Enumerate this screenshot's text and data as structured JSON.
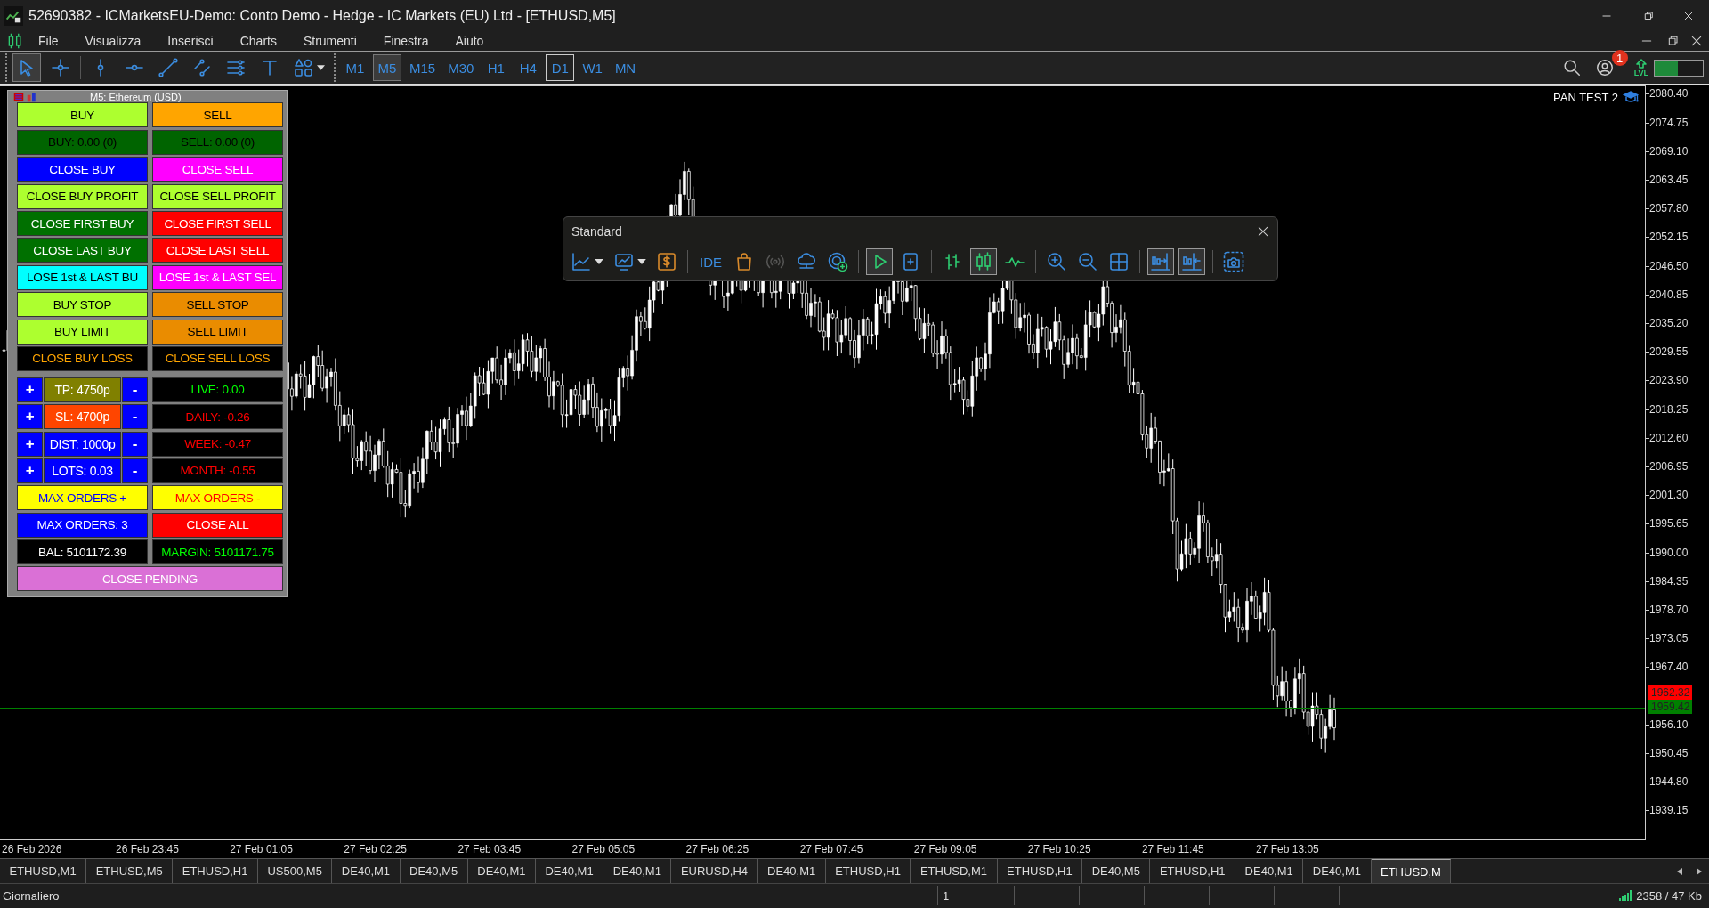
{
  "window": {
    "title": "52690382 - ICMarketsEU-Demo: Conto Demo - Hedge - IC Markets (EU) Ltd - [ETHUSD,M5]"
  },
  "menu": [
    "File",
    "Visualizza",
    "Inserisci",
    "Charts",
    "Strumenti",
    "Finestra",
    "Aiuto"
  ],
  "toolbar": {
    "tools": [
      {
        "kind": "cursor",
        "selected": true
      },
      {
        "kind": "crosshair",
        "selected": false
      },
      {
        "kind": "vline",
        "selected": false
      },
      {
        "kind": "hline",
        "selected": false
      },
      {
        "kind": "trendline",
        "selected": false
      },
      {
        "kind": "channel",
        "selected": false
      },
      {
        "kind": "fibo",
        "selected": false
      },
      {
        "kind": "text",
        "selected": false
      },
      {
        "kind": "shapes",
        "selected": false
      }
    ],
    "timeframes": [
      {
        "label": "M1",
        "selected": false,
        "marked": false
      },
      {
        "label": "M5",
        "selected": true,
        "marked": false
      },
      {
        "label": "M15",
        "selected": false,
        "marked": false
      },
      {
        "label": "M30",
        "selected": false,
        "marked": false
      },
      {
        "label": "H1",
        "selected": false,
        "marked": false
      },
      {
        "label": "H4",
        "selected": false,
        "marked": false
      },
      {
        "label": "D1",
        "selected": false,
        "marked": true
      },
      {
        "label": "W1",
        "selected": false,
        "marked": false
      },
      {
        "label": "MN",
        "selected": false,
        "marked": false
      }
    ],
    "notification_badge": "1",
    "lvl_label": "LVL",
    "meter": {
      "level": 0.48
    }
  },
  "chart": {
    "caption": "M5:  Ethereum (USD)",
    "label": "PAN TEST 2",
    "price_ticks": [
      "2080.40",
      "2074.75",
      "2069.10",
      "2063.45",
      "2057.80",
      "2052.15",
      "2046.50",
      "2040.85",
      "2035.20",
      "2029.55",
      "2023.90",
      "2018.25",
      "2012.60",
      "2006.95",
      "2001.30",
      "1995.65",
      "1990.00",
      "1984.35",
      "1978.70",
      "1973.05",
      "1967.40",
      "1956.10",
      "1950.45",
      "1944.80",
      "1939.15"
    ],
    "price_lines": [
      {
        "text": "1962.32",
        "color": "#ff0000"
      },
      {
        "text": "1959.42",
        "color": "#008000"
      }
    ],
    "time_ticks": [
      "26 Feb 2026",
      "26 Feb 23:45",
      "27 Feb 01:05",
      "27 Feb 02:25",
      "27 Feb 03:45",
      "27 Feb 05:05",
      "27 Feb 06:25",
      "27 Feb 07:45",
      "27 Feb 09:05",
      "27 Feb 10:25",
      "27 Feb 11:45",
      "27 Feb 13:05"
    ]
  },
  "trade_panel": {
    "rows": [
      {
        "kind": "pair",
        "cells": [
          {
            "text": "BUY",
            "color": "#adff2f",
            "text_style": {
              "color": "#000000"
            }
          },
          {
            "text": "SELL",
            "color": "#ffa500",
            "text_style": {
              "color": "#000000"
            }
          }
        ]
      },
      {
        "kind": "pair",
        "cells": [
          {
            "text": "BUY: 0.00 (0)",
            "color": "#006400",
            "text_style": {
              "color": "#000000"
            }
          },
          {
            "text": "SELL: 0.00 (0)",
            "color": "#006400",
            "text_style": {
              "color": "#000000"
            }
          }
        ]
      },
      {
        "kind": "pair",
        "cells": [
          {
            "text": "CLOSE BUY",
            "color": "#0000ff",
            "text_style": {
              "color": "#ffffff"
            }
          },
          {
            "text": "CLOSE SELL",
            "color": "#ff00ff",
            "text_style": {
              "color": "#ffffff"
            }
          }
        ]
      },
      {
        "kind": "pair",
        "cells": [
          {
            "text": "CLOSE BUY PROFIT",
            "color": "#adff2f",
            "text_style": {
              "color": "#000000"
            }
          },
          {
            "text": "CLOSE SELL PROFIT",
            "color": "#adff2f",
            "text_style": {
              "color": "#000000"
            }
          }
        ]
      },
      {
        "kind": "pair",
        "cells": [
          {
            "text": "CLOSE FIRST BUY",
            "color": "#007000",
            "text_style": {
              "color": "#ffffff"
            }
          },
          {
            "text": "CLOSE FIRST SELL",
            "color": "#ff0000",
            "text_style": {
              "color": "#ffffff"
            }
          }
        ]
      },
      {
        "kind": "pair",
        "cells": [
          {
            "text": "CLOSE LAST BUY",
            "color": "#007000",
            "text_style": {
              "color": "#ffffff"
            }
          },
          {
            "text": "CLOSE LAST SELL",
            "color": "#ff0000",
            "text_style": {
              "color": "#ffffff"
            }
          }
        ]
      },
      {
        "kind": "pair",
        "cells": [
          {
            "text": "LOSE 1st & LAST BU",
            "color": "#00ffff",
            "text_style": {
              "color": "#000000"
            }
          },
          {
            "text": "LOSE 1st & LAST SEL",
            "color": "#ff00ff",
            "text_style": {
              "color": "#ffffff"
            }
          }
        ]
      },
      {
        "kind": "pair",
        "cells": [
          {
            "text": "BUY STOP",
            "color": "#adff2f",
            "text_style": {
              "color": "#000000"
            }
          },
          {
            "text": "SELL STOP",
            "color": "#ea8c00",
            "text_style": {
              "color": "#000000"
            }
          }
        ]
      },
      {
        "kind": "pair",
        "cells": [
          {
            "text": "BUY LIMIT",
            "color": "#adff2f",
            "text_style": {
              "color": "#000000"
            }
          },
          {
            "text": "SELL LIMIT",
            "color": "#ea8c00",
            "text_style": {
              "color": "#000000"
            }
          }
        ]
      },
      {
        "kind": "pair",
        "cells": [
          {
            "text": "CLOSE BUY LOSS",
            "color": "#000000",
            "text_style": {
              "color": "#ffa500"
            }
          },
          {
            "text": "CLOSE SELL LOSS",
            "color": "#000000",
            "text_style": {
              "color": "#ffa500"
            }
          }
        ]
      },
      {
        "kind": "stepper",
        "cells": [
          {
            "text": "+",
            "color": "#0000ff",
            "text_style": {
              "color": "#ffffff"
            }
          },
          {
            "text": "TP: 4750p",
            "color": "#808000",
            "text_style": {
              "color": "#ffffff"
            }
          },
          {
            "text": "-",
            "color": "#0000ff",
            "text_style": {
              "color": "#ffffff"
            }
          },
          {
            "text": "LIVE: 0.00",
            "color": "#000000",
            "text_style": {
              "color": "#00ff00"
            }
          }
        ]
      },
      {
        "kind": "stepper",
        "cells": [
          {
            "text": "+",
            "color": "#0000ff",
            "text_style": {
              "color": "#ffffff"
            }
          },
          {
            "text": "SL: 4700p",
            "color": "#ff4500",
            "text_style": {
              "color": "#ffffff"
            }
          },
          {
            "text": "-",
            "color": "#0000ff",
            "text_style": {
              "color": "#ffffff"
            }
          },
          {
            "text": "DAILY: -0.26",
            "color": "#000000",
            "text_style": {
              "color": "#ff0000"
            }
          }
        ]
      },
      {
        "kind": "stepper",
        "cells": [
          {
            "text": "+",
            "color": "#0000ff",
            "text_style": {
              "color": "#ffffff"
            }
          },
          {
            "text": "DIST: 1000p",
            "color": "#0000ff",
            "text_style": {
              "color": "#ffffff"
            }
          },
          {
            "text": "-",
            "color": "#0000ff",
            "text_style": {
              "color": "#ffffff"
            }
          },
          {
            "text": "WEEK: -0.47",
            "color": "#000000",
            "text_style": {
              "color": "#ff0000"
            }
          }
        ]
      },
      {
        "kind": "stepper",
        "cells": [
          {
            "text": "+",
            "color": "#0000ff",
            "text_style": {
              "color": "#ffffff"
            }
          },
          {
            "text": "LOTS: 0.03",
            "color": "#0000ff",
            "text_style": {
              "color": "#ffffff"
            }
          },
          {
            "text": "-",
            "color": "#0000ff",
            "text_style": {
              "color": "#ffffff"
            }
          },
          {
            "text": "MONTH: -0.55",
            "color": "#000000",
            "text_style": {
              "color": "#ff0000"
            }
          }
        ]
      },
      {
        "kind": "pair",
        "cells": [
          {
            "text": "MAX ORDERS +",
            "color": "#ffff00",
            "text_style": {
              "color": "#0000ff"
            }
          },
          {
            "text": "MAX ORDERS -",
            "color": "#ffff00",
            "text_style": {
              "color": "#ff0000"
            }
          }
        ]
      },
      {
        "kind": "pair",
        "cells": [
          {
            "text": "MAX ORDERS: 3",
            "color": "#0000ff",
            "text_style": {
              "color": "#ffffff"
            }
          },
          {
            "text": "CLOSE ALL",
            "color": "#ff0000",
            "text_style": {
              "color": "#ffffff"
            }
          }
        ]
      },
      {
        "kind": "pair",
        "cells": [
          {
            "text": "BAL: 5101172.39",
            "color": "#000000",
            "text_style": {
              "color": "#ffffff"
            }
          },
          {
            "text": "MARGIN: 5101171.75",
            "color": "#000000",
            "text_style": {
              "color": "#00ff00"
            }
          }
        ]
      },
      {
        "kind": "wide",
        "cells": [
          {
            "text": "CLOSE PENDING",
            "color": "#da70d6",
            "text_style": {
              "color": "#ffffff"
            }
          }
        ]
      }
    ]
  },
  "standard_toolbar": {
    "title": "Standard",
    "groups": [
      [
        {
          "kind": "line-chart",
          "on": false,
          "disabled": false
        },
        {
          "kind": "monitor-chart",
          "on": false,
          "disabled": false
        },
        {
          "kind": "dollar",
          "on": false,
          "disabled": false
        }
      ],
      [
        {
          "kind": "ide",
          "text": "IDE",
          "on": false,
          "disabled": false
        },
        {
          "kind": "bag",
          "on": false,
          "disabled": false
        },
        {
          "kind": "signal",
          "on": false,
          "disabled": true
        },
        {
          "kind": "cloud",
          "on": false,
          "disabled": false
        },
        {
          "kind": "add-target",
          "on": false,
          "disabled": false
        }
      ],
      [
        {
          "kind": "play",
          "on": true,
          "disabled": false
        },
        {
          "kind": "new-doc",
          "on": false,
          "disabled": false
        }
      ],
      [
        {
          "kind": "bars",
          "on": false,
          "disabled": false
        },
        {
          "kind": "candles",
          "on": true,
          "disabled": false
        },
        {
          "kind": "line-wave",
          "on": false,
          "disabled": false
        }
      ],
      [
        {
          "kind": "zoom-in",
          "on": false,
          "disabled": false
        },
        {
          "kind": "zoom-out",
          "on": false,
          "disabled": false
        },
        {
          "kind": "grid",
          "on": false,
          "disabled": false
        }
      ],
      [
        {
          "kind": "shift-right",
          "on": true,
          "disabled": false
        },
        {
          "kind": "shift-left",
          "on": true,
          "disabled": false
        }
      ],
      [
        {
          "kind": "camera",
          "on": false,
          "disabled": false
        }
      ]
    ]
  },
  "tabs": [
    {
      "label": "ETHUSD,M1",
      "selected": false
    },
    {
      "label": "ETHUSD,M5",
      "selected": false
    },
    {
      "label": "ETHUSD,H1",
      "selected": false
    },
    {
      "label": "US500,M5",
      "selected": false
    },
    {
      "label": "DE40,M1",
      "selected": false
    },
    {
      "label": "DE40,M5",
      "selected": false
    },
    {
      "label": "DE40,M1",
      "selected": false
    },
    {
      "label": "DE40,M1",
      "selected": false
    },
    {
      "label": "DE40,M1",
      "selected": false
    },
    {
      "label": "EURUSD,H4",
      "selected": false
    },
    {
      "label": "DE40,M1",
      "selected": false
    },
    {
      "label": "ETHUSD,H1",
      "selected": false
    },
    {
      "label": "ETHUSD,M1",
      "selected": false
    },
    {
      "label": "ETHUSD,H1",
      "selected": false
    },
    {
      "label": "DE40,M5",
      "selected": false
    },
    {
      "label": "ETHUSD,H1",
      "selected": false
    },
    {
      "label": "DE40,M1",
      "selected": false
    },
    {
      "label": "DE40,M1",
      "selected": false
    },
    {
      "label": "ETHUSD,M",
      "selected": true
    }
  ],
  "status_bar": {
    "mode": "Giornaliero",
    "field_2": "1",
    "traffic": "2358 / 47 Kb"
  }
}
